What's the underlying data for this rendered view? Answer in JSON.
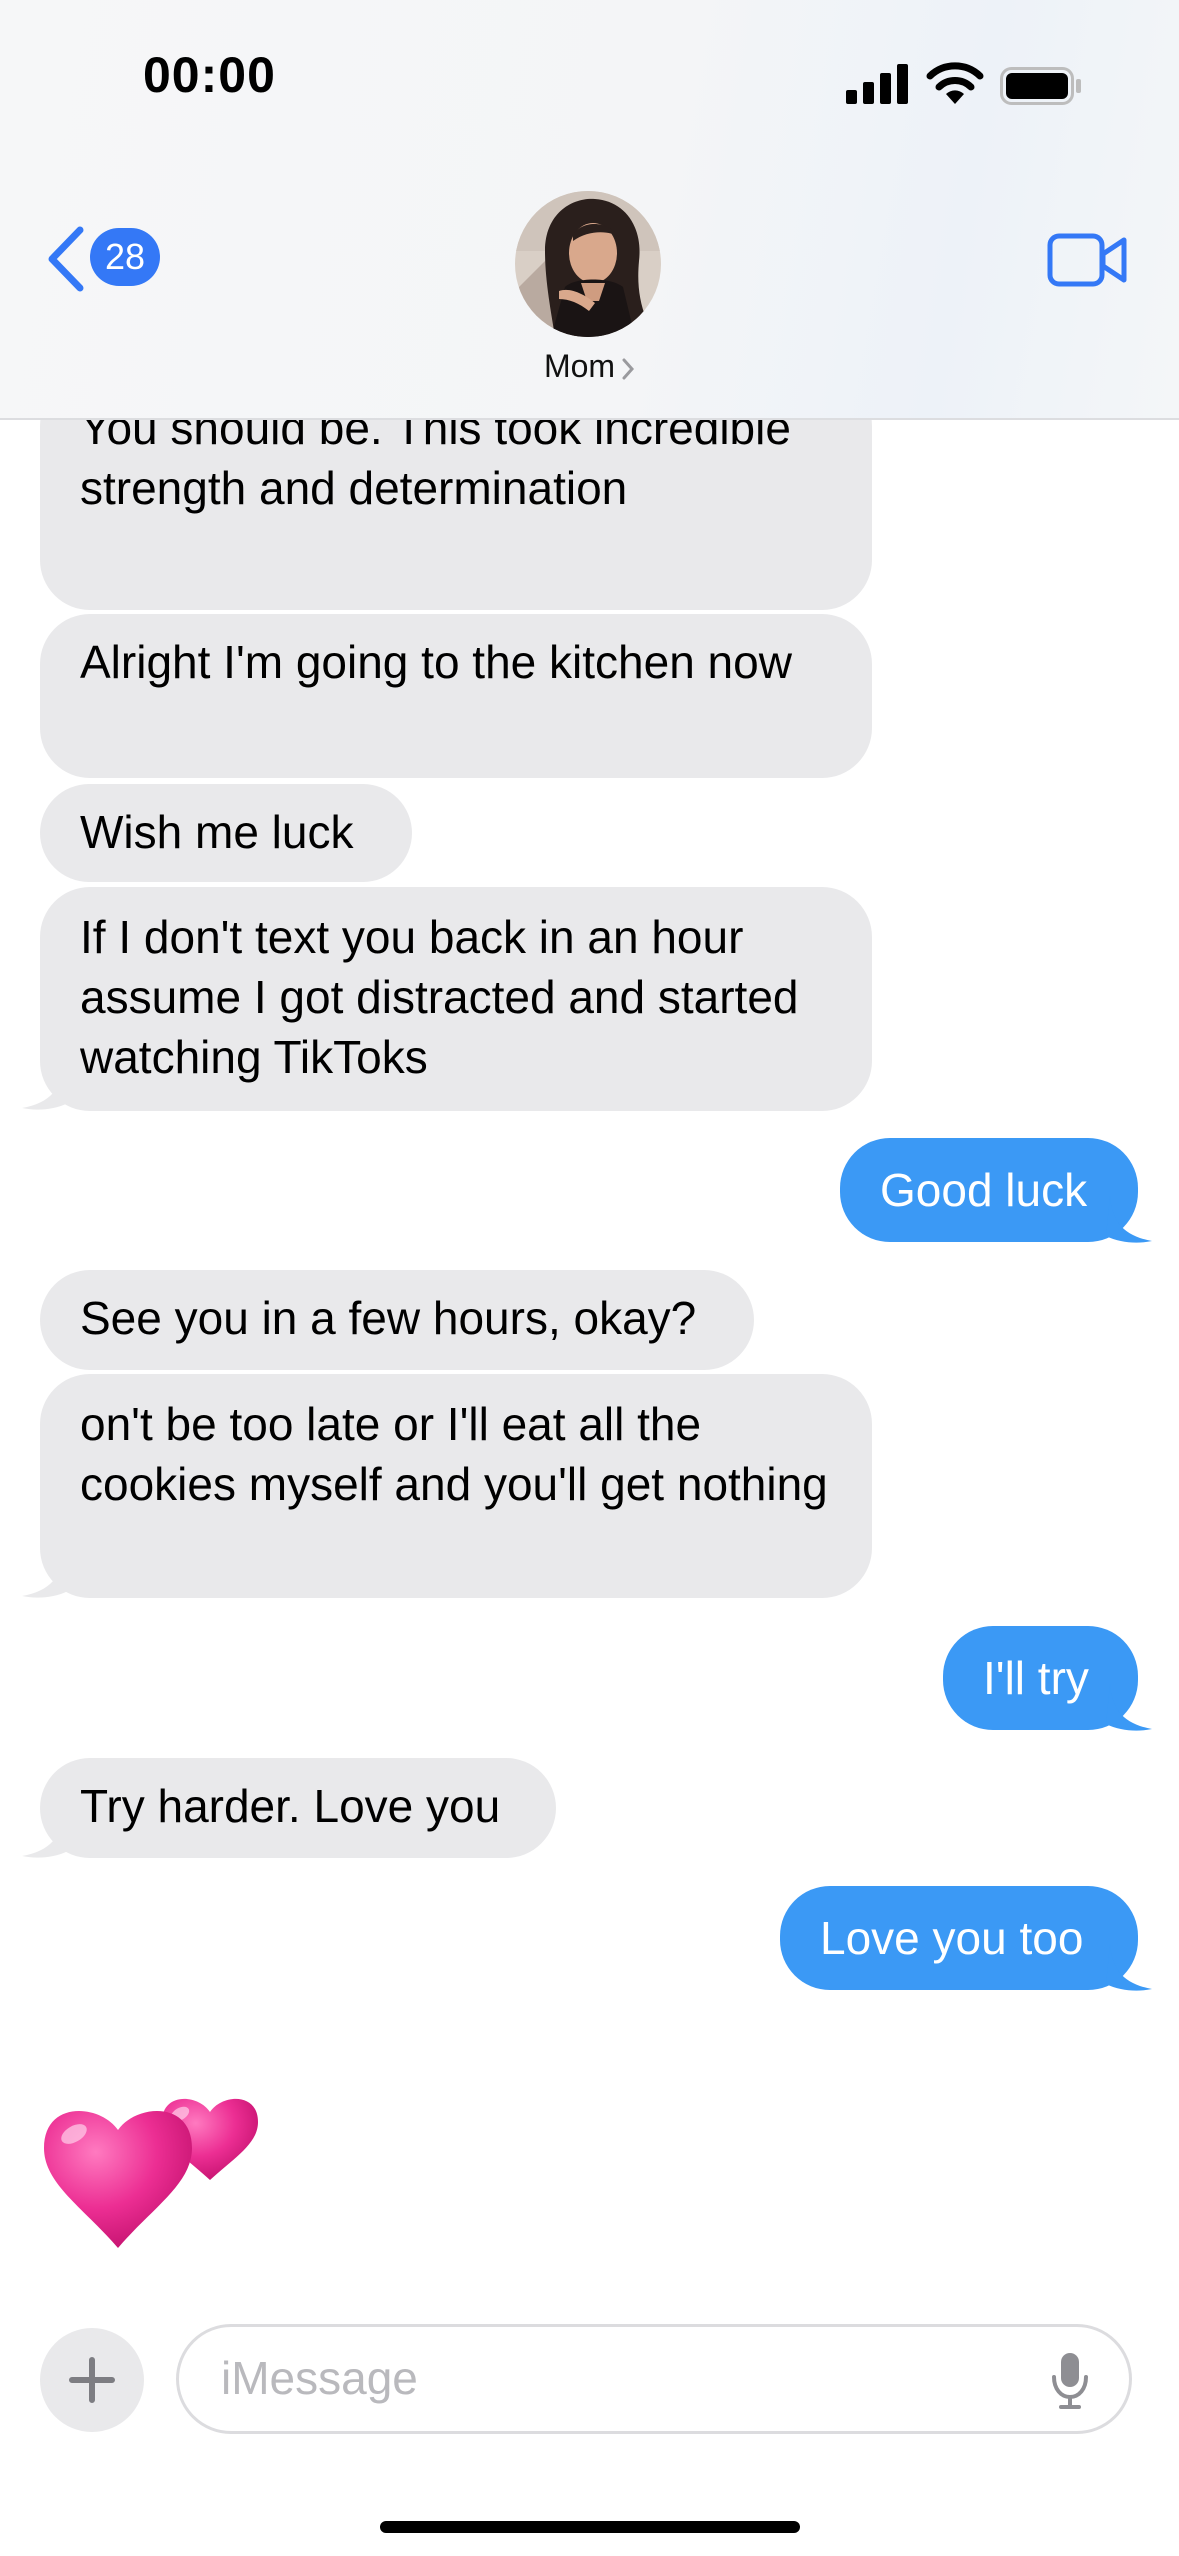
{
  "status_bar": {
    "time": "00:00"
  },
  "header": {
    "back_badge_count": "28",
    "contact_name": "Mom"
  },
  "messages": [
    {
      "sender": "contact",
      "text": "You should be. This took incredible strength and determination"
    },
    {
      "sender": "contact",
      "text": "Alright I'm going to the kitchen now"
    },
    {
      "sender": "contact",
      "text": "Wish me luck"
    },
    {
      "sender": "contact",
      "text": "If I don't text you back in an hour assume I got distracted and started watching TikToks"
    },
    {
      "sender": "me",
      "text": "Good luck"
    },
    {
      "sender": "contact",
      "text": "See you in a few hours, okay?"
    },
    {
      "sender": "contact",
      "text": "on't be too late or I'll eat all the cookies myself and you'll get nothing"
    },
    {
      "sender": "me",
      "text": "I'll try"
    },
    {
      "sender": "contact",
      "text": "Try harder. Love you"
    },
    {
      "sender": "me",
      "text": "Love you too"
    },
    {
      "sender": "contact",
      "emoji": "two-hearts"
    }
  ],
  "input_bar": {
    "placeholder": "iMessage"
  },
  "colors": {
    "sent_bubble": "#3b99f5",
    "received_bubble": "#e9e9eb",
    "accent": "#3478f6",
    "heart": "#e8288f"
  }
}
